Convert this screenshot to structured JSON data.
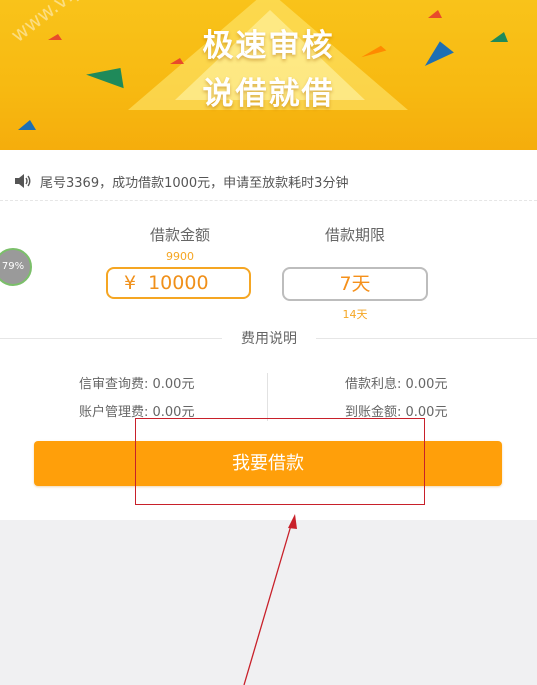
{
  "banner": {
    "title_line1": "极速审核",
    "title_line2": "说借就借",
    "watermark": "www.vipcn"
  },
  "notice": {
    "text": "尾号3369，成功借款1000元，申请至放款耗时3分钟"
  },
  "loan": {
    "amount_label": "借款金额",
    "amount_hint": "9900",
    "currency_symbol": "¥",
    "amount_value": "10000",
    "term_label": "借款期限",
    "term_value": "7天",
    "term_hint": "14天"
  },
  "progress_badge": "79%",
  "fees": {
    "title": "费用说明",
    "credit_check": "信审查询费: 0.00元",
    "account_mgmt": "账户管理费: 0.00元",
    "interest": "借款利息: 0.00元",
    "arrival": "到账金额: 0.00元"
  },
  "submit_label": "我要借款",
  "colors": {
    "accent": "#ff9f0a",
    "banner": "#f9c31a",
    "annotation": "#c8202a"
  }
}
